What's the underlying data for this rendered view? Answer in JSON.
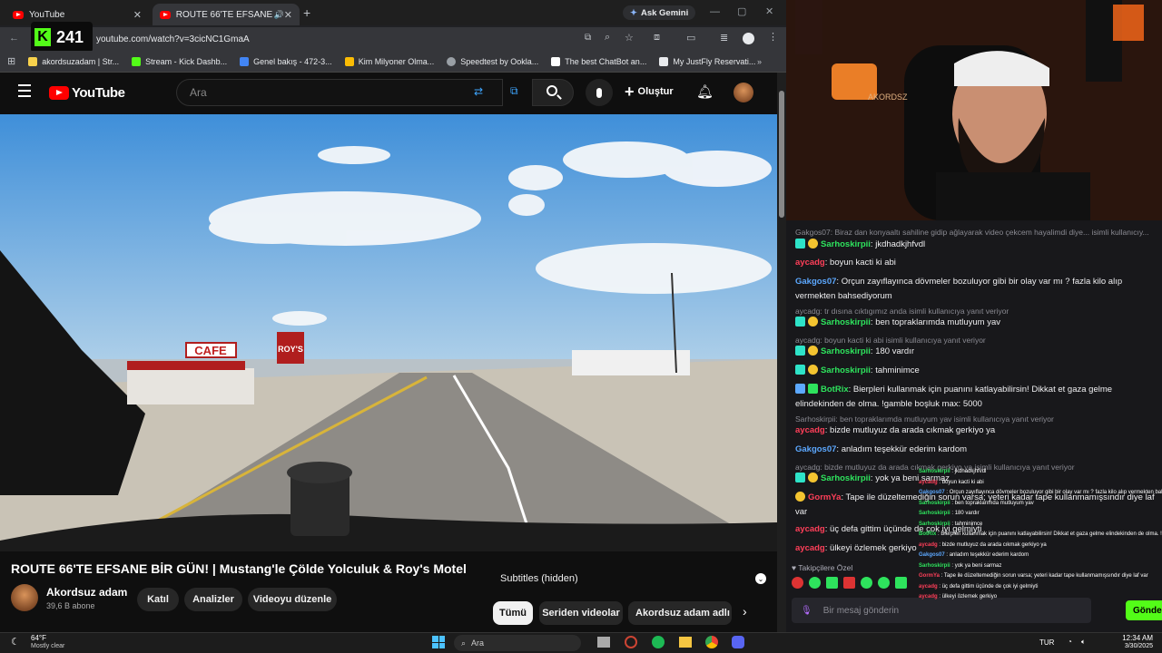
{
  "browser": {
    "tabs": [
      {
        "title": "YouTube"
      },
      {
        "title": "ROUTE 66'TE EFSANE BİR G"
      }
    ],
    "ask_gemini": "Ask Gemini",
    "url": "youtube.com/watch?v=3cicNC1GmaA",
    "viewer_count": "241",
    "bookmarks": [
      {
        "label": "akordsuzadam | Str...",
        "color": "#f7d14c"
      },
      {
        "label": "Stream - Kick Dashb...",
        "color": "#53fc18"
      },
      {
        "label": "Genel bakış - 472-3...",
        "color": "#4285f4"
      },
      {
        "label": "Kim Milyoner Olma...",
        "color": "#fbbc04"
      },
      {
        "label": "Speedtest by Ookla...",
        "color": "#9aa0a6"
      },
      {
        "label": "The best ChatBot an...",
        "color": "#ffffff"
      },
      {
        "label": "My JustFly Reservati...",
        "color": "#e8eaed"
      }
    ]
  },
  "youtube": {
    "logo_text": "YouTube",
    "search_placeholder": "Ara",
    "create_label": "Oluştur",
    "video_title": "ROUTE 66'TE EFSANE BİR GÜN! | Mustang'le Çölde Yolculuk & Roy's Motel",
    "channel_name": "Akordsuz adam",
    "subscribers": "39,6 B abone",
    "buttons": {
      "join": "Katıl",
      "analytics": "Analizler",
      "edit": "Videoyu düzenle"
    },
    "subtitles_label": "Subtitles (hidden)",
    "filters": [
      "Tümü",
      "Seriden videolar",
      "Akordsuz adam adlı y"
    ]
  },
  "chat": {
    "messages": [
      {
        "type": "reply",
        "text": "Gakgos07: Biraz dan konyaaltı sahiline gidip ağlayarak video çekcem hayalimdi diye... isimli kullanıcıy..."
      },
      {
        "user": "Sarhoskirpii",
        "color": "#2ee35d",
        "text": "jkdhadkjhfvdl",
        "badges": true
      },
      {
        "user": "aycadg",
        "color": "#ff3f59",
        "text": "boyun kacti ki abi"
      },
      {
        "user": "Gakgos07",
        "color": "#5ca8ff",
        "text": "Orçun zayıflayınca dövmeler bozuluyor gibi bir olay var mı ? fazla kilo alıp vermekten bahsediyorum"
      },
      {
        "type": "reply",
        "text": "aycadg: tr dısına cıktıgımız anda isimli kullanıcıya yanıt veriyor"
      },
      {
        "user": "Sarhoskirpii",
        "color": "#2ee35d",
        "text": "ben topraklarımda mutluyum yav",
        "badges": true
      },
      {
        "type": "reply",
        "text": "aycadg: boyun kacti ki abi isimli kullanıcıya yanıt veriyor"
      },
      {
        "user": "Sarhoskirpii",
        "color": "#2ee35d",
        "text": "180 vardır",
        "badges": true
      },
      {
        "user": "Sarhoskirpii",
        "color": "#2ee35d",
        "text": "tahminimce",
        "badges": true
      },
      {
        "user": "BotRix",
        "color": "#2ee35d",
        "text": "Bierpleri kullanmak için puanını katlayabilirsin! Dikkat et gaza gelme elindekinden de olma. !gamble boşluk max: 5000"
      },
      {
        "type": "reply",
        "text": "Sarhoskirpii: ben topraklarımda mutluyum yav isimli kullanıcıya yanıt veriyor"
      },
      {
        "user": "aycadg",
        "color": "#ff3f59",
        "text": "bizde mutluyuz da arada cıkmak gerkiyo ya"
      },
      {
        "user": "Gakgos07",
        "color": "#5ca8ff",
        "text": "anladım teşekkür ederim kardom"
      },
      {
        "type": "reply",
        "text": "aycadg: bizde mutluyuz da arada cıkmak gerkiyo ya isimli kullanıcıya yanıt veriyor"
      },
      {
        "user": "Sarhoskirpii",
        "color": "#2ee35d",
        "text": "yok ya beni sarmaz",
        "badges": true
      },
      {
        "user": "GormYa",
        "color": "#ff3f59",
        "text": "Tape ile düzeltemediğin sorun varsa; yeteri kadar tape kullanmamışsındır diye laf var"
      },
      {
        "user": "aycadg",
        "color": "#ff3f59",
        "text": "üç defa gittim üçünde de çok iyi gelmiyti"
      },
      {
        "user": "aycadg",
        "color": "#ff3f59",
        "text": "ülkeyi özlemek gerkiyo"
      }
    ],
    "followers_only": "Takipçilere Özel",
    "input_placeholder": "Bir mesaj gönderin",
    "send_label": "Gönder"
  },
  "overlay_chat": [
    {
      "user": "Sarhoskirpii",
      "text": "jkdhadkjhfvdl",
      "color": "#2ee35d"
    },
    {
      "user": "aycadg",
      "text": "boyun kacti ki abi",
      "color": "#ff3f59"
    },
    {
      "user": "Gakgos07",
      "text": "Orçun zayıflayınca dövmeler bozuluyor gibi bir olay var mı ? fazla kilo alıp vermekten bahsediyorum",
      "color": "#5ca8ff"
    },
    {
      "user": "Sarhoskirpii",
      "text": "ben topraklarımda mutluyum yav",
      "color": "#2ee35d"
    },
    {
      "user": "Sarhoskirpii",
      "text": "180 vardır",
      "color": "#2ee35d"
    },
    {
      "user": "Sarhoskirpii",
      "text": "tahminimce",
      "color": "#2ee35d"
    },
    {
      "user": "BotRix",
      "text": "Bierpleri kullanmak için puanını katlayabilirsin! Dikkat et gaza gelme elindekinden de olma. !gamble boşluk max: 5000",
      "color": "#2ee35d"
    },
    {
      "user": "aycadg",
      "text": "bizde mutluyuz da arada cıkmak gerkiyo ya",
      "color": "#ff3f59"
    },
    {
      "user": "Gakgos07",
      "text": "anladım teşekkür ederim kardom",
      "color": "#5ca8ff"
    },
    {
      "user": "Sarhoskirpii",
      "text": "yok ya beni sarmaz",
      "color": "#2ee35d"
    },
    {
      "user": "GormYa",
      "text": "Tape ile düzeltemediğin sorun varsa; yeteri kadar tape kullanmamışsındır diye laf var",
      "color": "#ff3f59"
    },
    {
      "user": "aycadg",
      "text": "üç defa gittim üçünde de çok iyi gelmiyti",
      "color": "#ff3f59"
    },
    {
      "user": "aycadg",
      "text": "ülkeyi özlemek gerkiyo",
      "color": "#ff3f59"
    }
  ],
  "taskbar": {
    "weather_temp": "64°F",
    "weather_desc": "Mostly clear",
    "search_label": "Ara",
    "lang": "TUR",
    "time": "12:34 AM",
    "date": "3/30/2025"
  },
  "video_scene": {
    "sign": "CAFE",
    "motel_sign": "ROY'S"
  }
}
